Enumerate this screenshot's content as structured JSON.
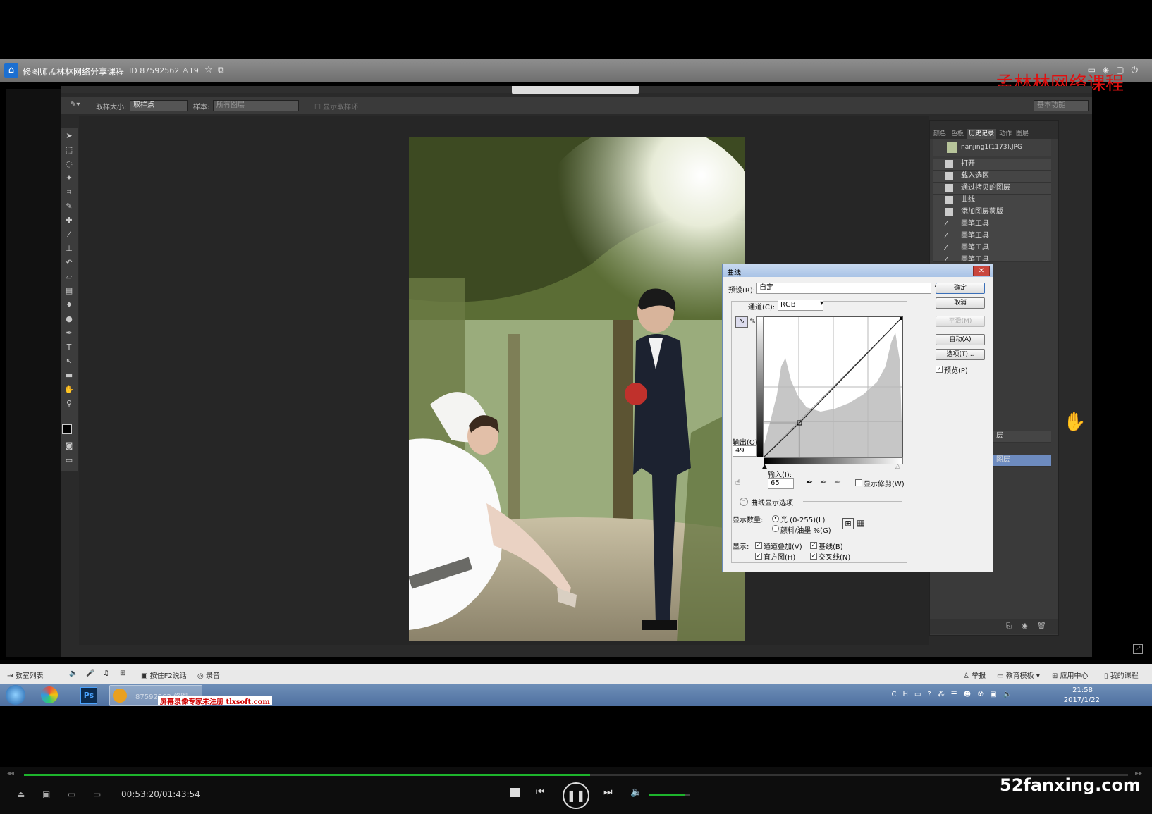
{
  "room": {
    "title": "修图师孟林林网络分享课程",
    "id": "ID 87592562",
    "users": "19",
    "watermark": "孟林林网络课程"
  },
  "ps": {
    "options": {
      "sample_size_label": "取样大小:",
      "sample_size_value": "取样点",
      "sample_label": "样本:",
      "sample_value": "所有图层",
      "show_ring": "显示取样环",
      "workspace": "基本功能"
    },
    "history": {
      "tabs": [
        "颜色",
        "色板",
        "历史记录",
        "动作",
        "图层"
      ],
      "snapshot": "nanjing1(1173).JPG",
      "items": [
        "打开",
        "载入选区",
        "通过拷贝的图层",
        "曲线",
        "添加图层蒙版",
        "画笔工具",
        "画笔工具",
        "画笔工具",
        "画笔工具"
      ],
      "tail1": "层",
      "tail2": "图层"
    }
  },
  "curves": {
    "title": "曲线",
    "preset_label": "预设(R):",
    "preset_value": "自定",
    "channel_label": "通道(C):",
    "channel_value": "RGB",
    "output_label": "输出(O):",
    "output_value": "49",
    "input_label": "输入(I):",
    "input_value": "65",
    "show_clipping": "显示修剪(W)",
    "display_options": "曲线显示选项",
    "show_amount_label": "显示数量:",
    "light_option": "光 (0-255)(L)",
    "pigment_option": "颜料/油墨 %(G)",
    "show_label": "显示:",
    "channel_overlays": "通道叠加(V)",
    "baseline": "基线(B)",
    "histogram": "直方图(H)",
    "intersection": "交叉线(N)",
    "buttons": {
      "ok": "确定",
      "cancel": "取消",
      "smooth": "平滑(M)",
      "auto": "自动(A)",
      "options": "选项(T)...",
      "preview": "预览(P)"
    }
  },
  "status": {
    "class_list": "教室列表",
    "hold_f2": "按住F2说话",
    "record": "录音",
    "report": "举报",
    "edu_template": "教育模板",
    "app_center": "应用中心",
    "my_courses": "我的课程"
  },
  "taskbar": {
    "window_label": "87592562 修图",
    "unregistered": "屏幕录像专家未注册 tlxsoft.com",
    "time": "21:58",
    "date": "2017/1/22"
  },
  "player": {
    "timecode": "00:53:20/01:43:54",
    "progress": 0.513,
    "volume": 0.9,
    "site": "52fanxing.com"
  }
}
